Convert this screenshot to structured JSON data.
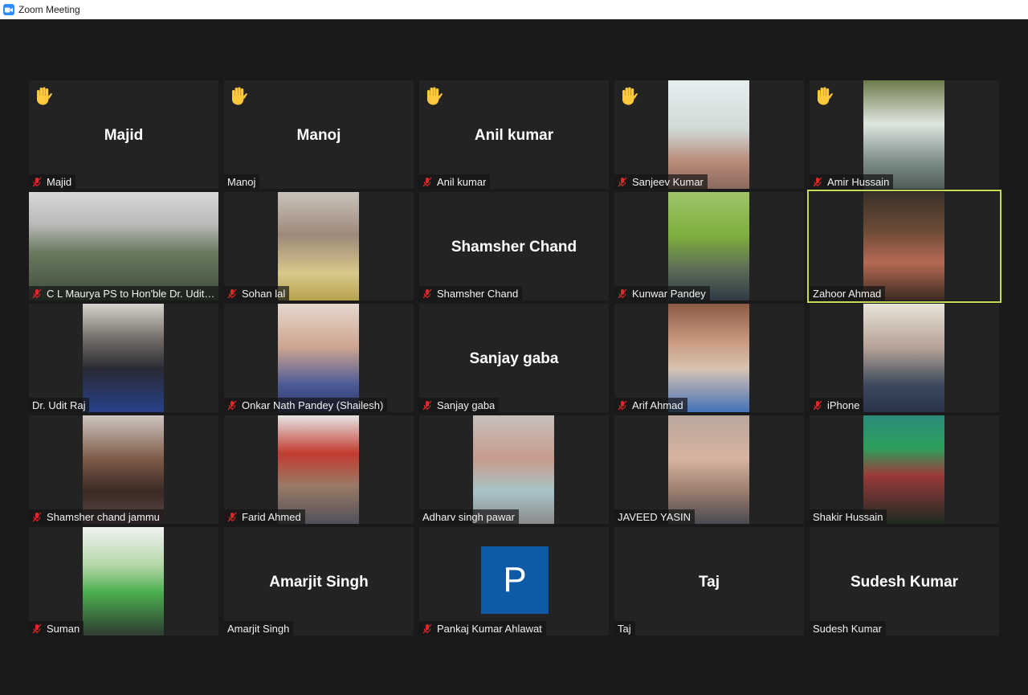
{
  "window": {
    "title": "Zoom Meeting"
  },
  "colors": {
    "active_speaker": "#c5da5a",
    "raised_hand": "#ffc83d",
    "muted_mic": "#e02828",
    "avatar": "#0e5aa7"
  },
  "participants": [
    {
      "label": "Majid",
      "display_name": "Majid",
      "hand_raised": true,
      "muted": true,
      "video": false
    },
    {
      "label": "Manoj",
      "display_name": "Manoj",
      "hand_raised": true,
      "muted": false,
      "video": false
    },
    {
      "label": "Anil kumar",
      "display_name": "Anil kumar",
      "hand_raised": true,
      "muted": true,
      "video": false
    },
    {
      "label": "Sanjeev Kumar",
      "hand_raised": true,
      "muted": true,
      "video": true
    },
    {
      "label": "Amir Hussain",
      "hand_raised": true,
      "muted": true,
      "video": true
    },
    {
      "label": "C L Maurya PS to Hon'ble Dr. Udit ...",
      "hand_raised": false,
      "muted": true,
      "video": true
    },
    {
      "label": "Sohan lal",
      "hand_raised": false,
      "muted": true,
      "video": true
    },
    {
      "label": "Shamsher Chand",
      "display_name": "Shamsher Chand",
      "hand_raised": false,
      "muted": true,
      "video": false
    },
    {
      "label": "Kunwar Pandey",
      "hand_raised": false,
      "muted": true,
      "video": true
    },
    {
      "label": "Zahoor Ahmad",
      "hand_raised": false,
      "muted": false,
      "video": true,
      "active_speaker": true
    },
    {
      "label": "Dr. Udit Raj",
      "hand_raised": false,
      "muted": false,
      "video": true
    },
    {
      "label": "Onkar Nath Pandey (Shailesh)",
      "hand_raised": false,
      "muted": true,
      "video": true
    },
    {
      "label": "Sanjay gaba",
      "display_name": "Sanjay gaba",
      "hand_raised": false,
      "muted": true,
      "video": false
    },
    {
      "label": "Arif Ahmad",
      "hand_raised": false,
      "muted": true,
      "video": true
    },
    {
      "label": "iPhone",
      "hand_raised": false,
      "muted": true,
      "video": true
    },
    {
      "label": "Shamsher chand jammu",
      "hand_raised": false,
      "muted": true,
      "video": true
    },
    {
      "label": "Farid Ahmed",
      "hand_raised": false,
      "muted": true,
      "video": true
    },
    {
      "label": "Adharv singh pawar",
      "hand_raised": false,
      "muted": false,
      "video": true
    },
    {
      "label": "JAVEED YASIN",
      "hand_raised": false,
      "muted": false,
      "video": true
    },
    {
      "label": "Shakir Hussain",
      "hand_raised": false,
      "muted": false,
      "video": true
    },
    {
      "label": "Suman",
      "hand_raised": false,
      "muted": true,
      "video": true
    },
    {
      "label": "Amarjit Singh",
      "display_name": "Amarjit Singh",
      "hand_raised": false,
      "muted": false,
      "video": false
    },
    {
      "label": "Pankaj Kumar Ahlawat",
      "avatar_letter": "P",
      "hand_raised": false,
      "muted": true,
      "video": false
    },
    {
      "label": "Taj",
      "display_name": "Taj",
      "hand_raised": false,
      "muted": false,
      "video": false
    },
    {
      "label": "Sudesh Kumar",
      "display_name": "Sudesh Kumar",
      "hand_raised": false,
      "muted": false,
      "video": false
    }
  ]
}
